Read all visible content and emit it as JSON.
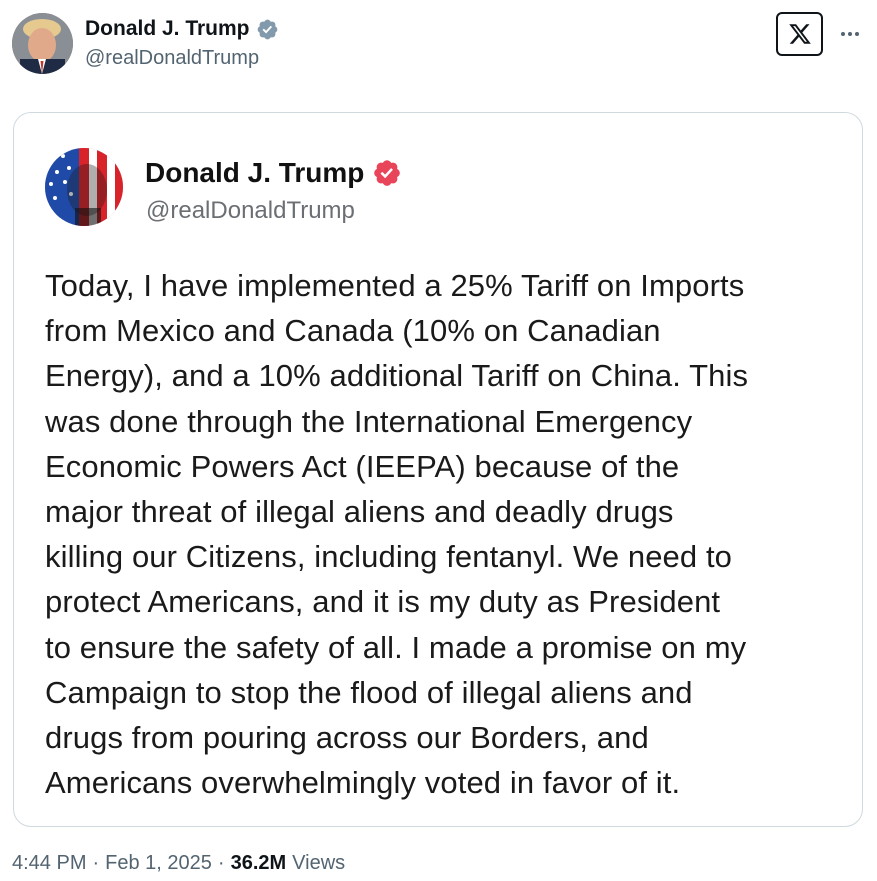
{
  "tweet": {
    "author": {
      "display_name": "Donald J. Trump",
      "handle": "@realDonaldTrump",
      "verified": true,
      "badge_color": "#829aab",
      "avatar_icon": "profile-photo"
    },
    "platform_icon": "x-logo-icon",
    "menu_icon": "more-icon",
    "timestamp": "4:44 PM",
    "date": "Feb 1, 2025",
    "separator": "·",
    "views_count": "36.2M",
    "views_label": "Views"
  },
  "embedded_post": {
    "author": {
      "display_name": "Donald J. Trump",
      "handle": "@realDonaldTrump",
      "verified": true,
      "badge_color": "#e8455b",
      "avatar_icon": "flag-portrait-avatar"
    },
    "text": "Today, I have implemented a 25% Tariff on Imports\nfrom Mexico and Canada (10% on Canadian\nEnergy), and a 10% additional Tariff on China. This\nwas done through the International Emergency\nEconomic Powers Act (IEEPA) because of the\nmajor threat of illegal aliens and deadly drugs\nkilling our Citizens, including fentanyl. We need to\nprotect Americans, and it is my duty as President\nto ensure the safety of all. I made a promise on my\nCampaign to stop the flood of illegal aliens and\ndrugs from pouring across our Borders, and\nAmericans overwhelmingly voted in favor of it."
  },
  "colors": {
    "text_primary": "#0f1419",
    "text_secondary": "#536471",
    "card_border": "#cfd9de"
  }
}
